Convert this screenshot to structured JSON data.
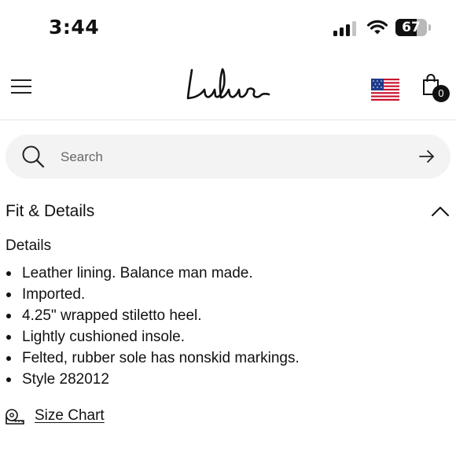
{
  "status_bar": {
    "time": "3:44",
    "battery_level": "67",
    "battery_fraction": 0.67
  },
  "header": {
    "logo_text": "Lulus",
    "cart_count": "0",
    "region_flag": "us-flag-icon"
  },
  "search": {
    "placeholder": "Search",
    "value": ""
  },
  "section": {
    "title": "Fit & Details",
    "expanded": true,
    "details_heading": "Details",
    "items": [
      "Leather lining. Balance man made.",
      "Imported.",
      "4.25\" wrapped stiletto heel.",
      "Lightly cushioned insole.",
      "Felted, rubber sole has nonskid markings.",
      "Style 282012"
    ]
  },
  "size_chart": {
    "label": "Size Chart"
  },
  "icons": {
    "menu": "hamburger-menu-icon",
    "search": "search-icon",
    "submit": "arrow-right-icon",
    "collapse": "chevron-up-icon",
    "cart": "shopping-bag-icon",
    "size_chart": "measuring-tape-icon"
  }
}
